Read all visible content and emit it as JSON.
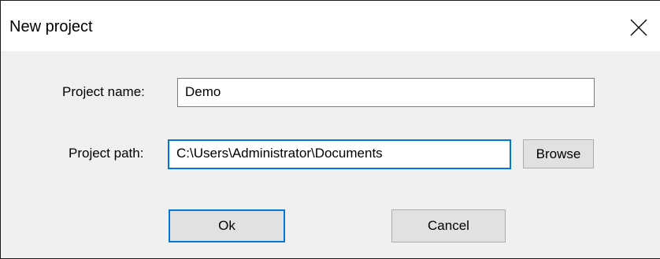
{
  "dialog": {
    "title": "New project",
    "close_icon": "close-icon"
  },
  "form": {
    "project_name_label": "Project name:",
    "project_name_value": "Demo",
    "project_path_label": "Project path:",
    "project_path_value": "C:\\Users\\Administrator\\Documents",
    "browse_label": "Browse"
  },
  "buttons": {
    "ok_label": "Ok",
    "cancel_label": "Cancel"
  },
  "colors": {
    "focus_accent": "#0078d7",
    "dialog_background": "#f0f0f0",
    "button_face": "#e1e1e1"
  }
}
